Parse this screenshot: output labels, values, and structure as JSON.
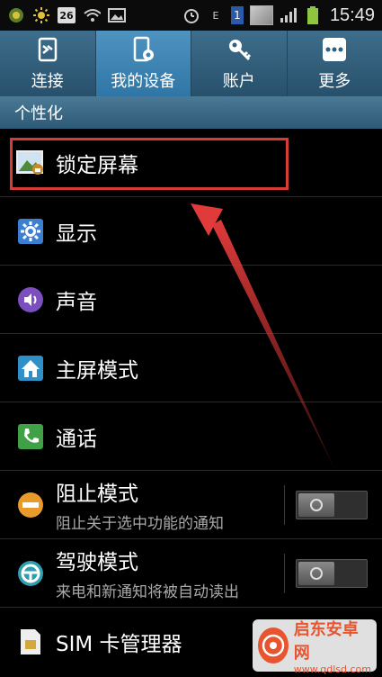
{
  "statusbar": {
    "date_badge": "26",
    "sim_label": "1",
    "network_label": "E",
    "time": "15:49",
    "icons": [
      "signal-app-icon",
      "brightness-icon",
      "calendar-icon",
      "wifi-icon",
      "image-icon",
      "alarm-icon",
      "sim-icon",
      "cell-signal-icon",
      "battery-icon"
    ]
  },
  "tabs": [
    {
      "label": "连接",
      "icon": "connections-icon",
      "active": false
    },
    {
      "label": "我的设备",
      "icon": "my-device-icon",
      "active": true
    },
    {
      "label": "账户",
      "icon": "accounts-key-icon",
      "active": false
    },
    {
      "label": "更多",
      "icon": "more-dots-icon",
      "active": false
    }
  ],
  "section_title": "个性化",
  "items": [
    {
      "label": "锁定屏幕",
      "icon": "lock-screen-icon"
    },
    {
      "label": "显示",
      "icon": "display-gear-icon"
    },
    {
      "label": "声音",
      "icon": "sound-icon"
    },
    {
      "label": "主屏模式",
      "icon": "home-screen-icon"
    },
    {
      "label": "通话",
      "icon": "phone-call-icon"
    },
    {
      "label": "阻止模式",
      "sub": "阻止关于选中功能的通知",
      "icon": "block-mode-icon",
      "toggle": "off"
    },
    {
      "label": "驾驶模式",
      "sub": "来电和新通知将被自动读出",
      "icon": "driving-mode-icon",
      "toggle": "off"
    },
    {
      "label": "SIM 卡管理器",
      "icon": "sim-card-icon"
    }
  ],
  "watermark": {
    "title": "启东安卓网",
    "url": "www.qdlsd.com"
  },
  "colors": {
    "tab_bar": "#2f5f7d",
    "tab_active": "#3f86b6",
    "highlight": "#d83a3a",
    "arrow": "#e03a3a"
  }
}
